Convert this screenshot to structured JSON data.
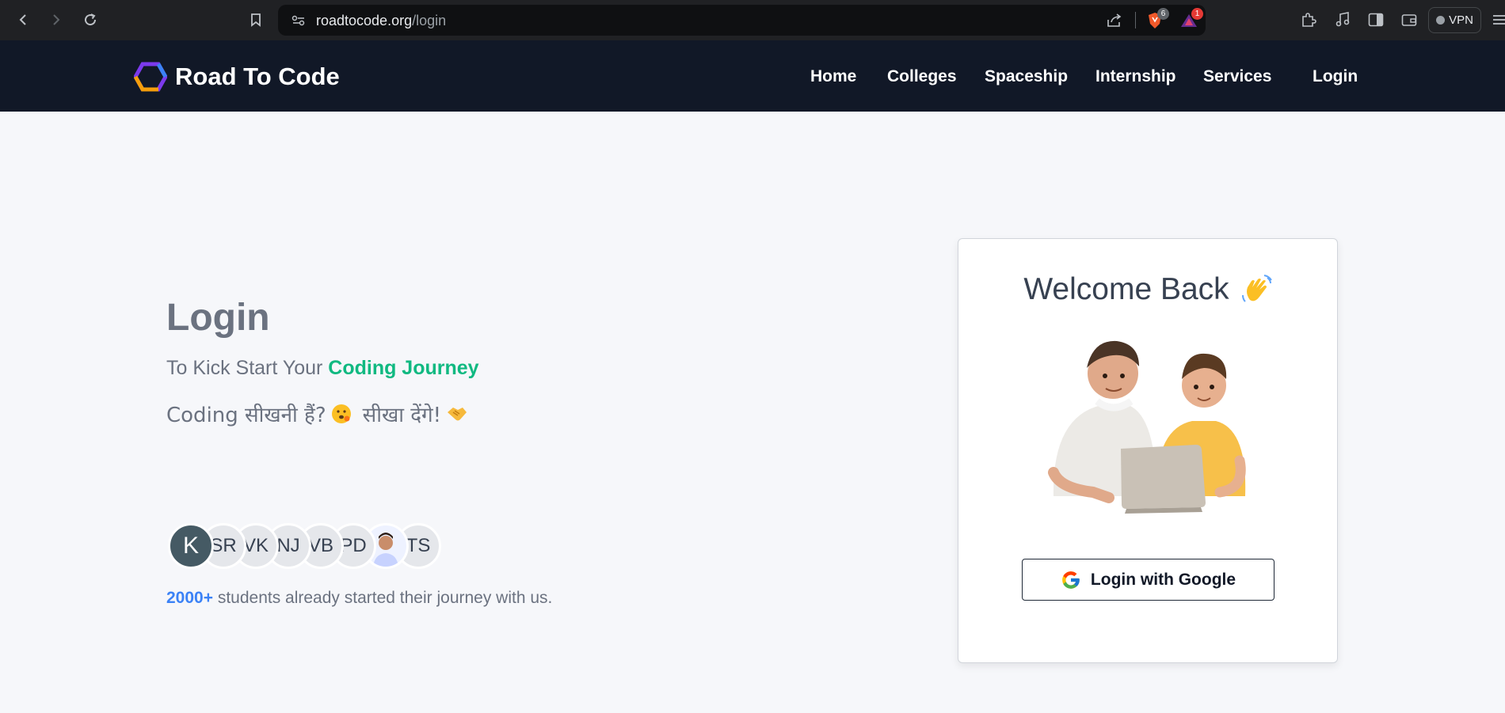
{
  "browser": {
    "url_host": "roadtocode.org",
    "url_path": "/login",
    "brave_badge": "6",
    "alert_badge": "1",
    "vpn_label": "VPN"
  },
  "header": {
    "brand": "Road To Code",
    "nav": [
      "Home",
      "Colleges",
      "Spaceship",
      "Internship",
      "Services",
      "Login"
    ]
  },
  "hero": {
    "title": "Login",
    "subtitle_prefix": "To Kick Start Your ",
    "subtitle_accent": "Coding Journey",
    "hindi_part1": "Coding सीखनी हैं?",
    "hindi_part2": "सीखा देंगे!",
    "avatars": [
      "K",
      "SR",
      "VK",
      "NJ",
      "VB",
      "PD",
      "",
      "TS"
    ],
    "students_count": "2000+",
    "students_text": " students already started their journey with us."
  },
  "card": {
    "welcome": "Welcome Back",
    "google_button": "Login with Google"
  },
  "colors": {
    "header_bg": "#111827",
    "accent_green": "#10b981",
    "accent_blue": "#3b82f6"
  }
}
